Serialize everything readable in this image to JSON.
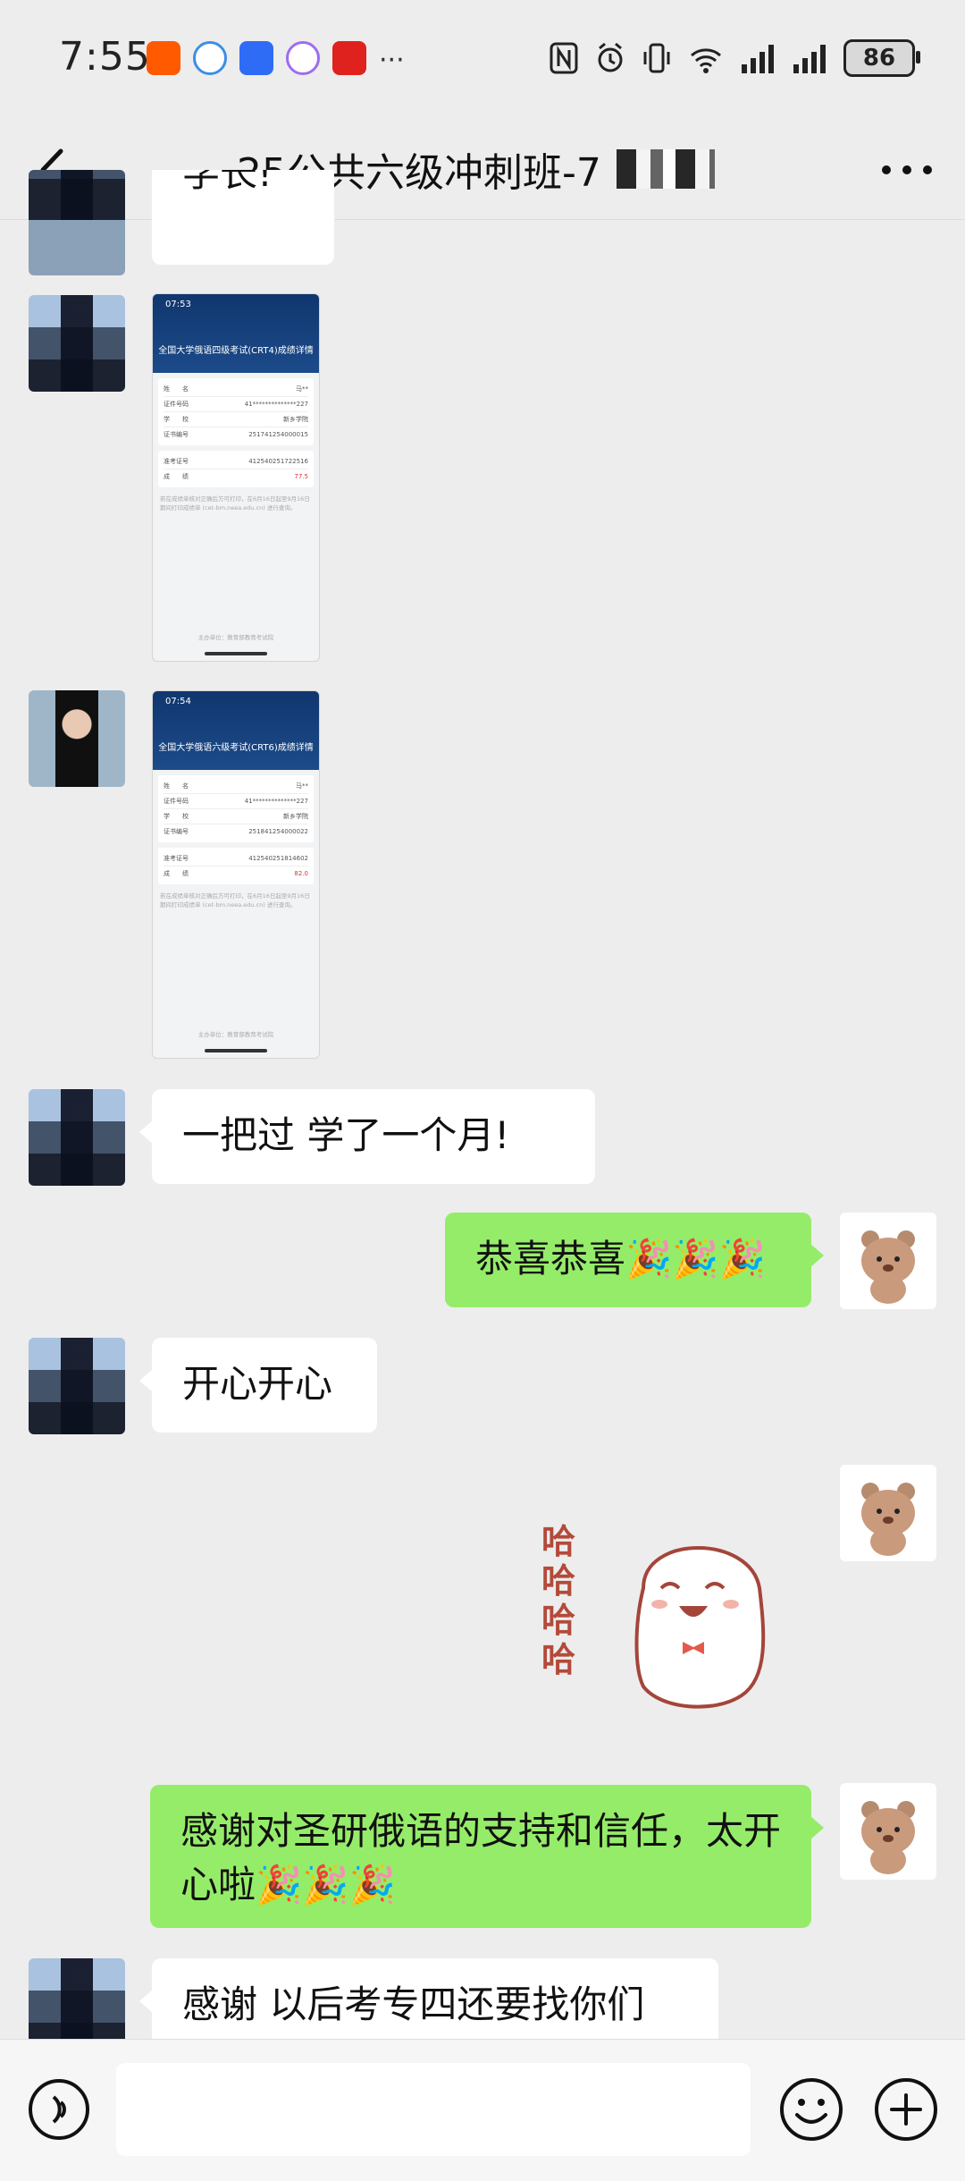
{
  "status_bar": {
    "time": "7:55",
    "battery": "86"
  },
  "nav": {
    "title": "25公共六级冲刺班-7"
  },
  "messages": {
    "partial_text": "学长!",
    "shot1": {
      "time": "07:53",
      "title": "全国大学俄语四级考试(CRT4)成绩详情",
      "rows": [
        {
          "k": "姓　　名",
          "v": "马**"
        },
        {
          "k": "证件号码",
          "v": "41**************227"
        },
        {
          "k": "学　　校",
          "v": "新乡学院"
        },
        {
          "k": "证书编号",
          "v": "251741254000015"
        }
      ],
      "rows2": [
        {
          "k": "准考证号",
          "v": "412540251722516"
        },
        {
          "k": "成　　绩",
          "v": "77.5"
        }
      ],
      "note": "若在成绩单核对正确后方可打印，在6月16日起至9月16日期间打印成绩单 (cet-bm.neea.edu.cn) 进行查询。",
      "footer": "主办单位：教育部教育考试院"
    },
    "shot2": {
      "time": "07:54",
      "title": "全国大学俄语六级考试(CRT6)成绩详情",
      "rows": [
        {
          "k": "姓　　名",
          "v": "马**"
        },
        {
          "k": "证件号码",
          "v": "41**************227"
        },
        {
          "k": "学　　校",
          "v": "新乡学院"
        },
        {
          "k": "证书编号",
          "v": "251841254000022"
        }
      ],
      "rows2": [
        {
          "k": "准考证号",
          "v": "412540251814602"
        },
        {
          "k": "成　　绩",
          "v": "82.0"
        }
      ],
      "note": "若在成绩单核对正确后方可打印，在6月16日起至9月16日期间打印成绩单 (cet-bm.neea.edu.cn) 进行查询。",
      "footer": "主办单位：教育部教育考试院"
    },
    "m1": "一把过 学了一个月!",
    "m2": "恭喜恭喜🎉🎉🎉",
    "m3": "开心开心",
    "sticker_text": "哈哈哈哈",
    "m4": "感谢对圣研俄语的支持和信任，太开心啦🎉🎉🎉",
    "m5": "感谢 以后考专四还要找你们"
  },
  "input": {
    "placeholder": ""
  }
}
